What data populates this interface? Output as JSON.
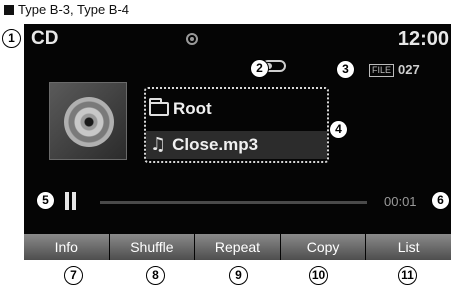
{
  "caption": "Type B-3, Type B-4",
  "header": {
    "source": "CD",
    "clock": "12:00"
  },
  "status": {
    "file_badge": "FILE",
    "file_count": "027"
  },
  "track": {
    "folder": "Root",
    "file": "Close.mp3"
  },
  "playback": {
    "elapsed": "00:01",
    "progress": 0.0
  },
  "softkeys": [
    {
      "label": "Info"
    },
    {
      "label": "Shuffle"
    },
    {
      "label": "Repeat"
    },
    {
      "label": "Copy"
    },
    {
      "label": "List"
    }
  ],
  "callouts": [
    "1",
    "2",
    "3",
    "4",
    "5",
    "6",
    "7",
    "8",
    "9",
    "10",
    "11"
  ],
  "icons": [
    "disc-icon",
    "repeat-icon",
    "folder-icon",
    "music-note-icon",
    "pause-icon"
  ]
}
